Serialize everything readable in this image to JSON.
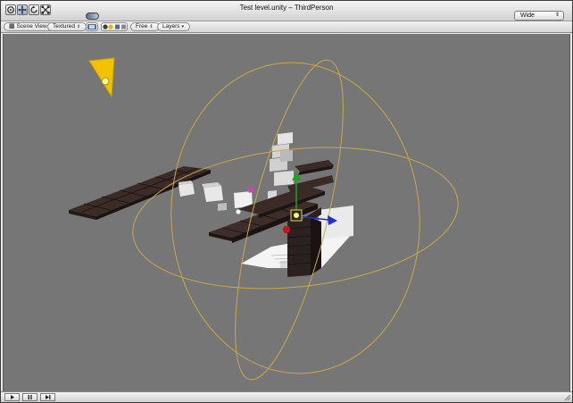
{
  "window": {
    "title": "Test level.unity – ThirdPerson"
  },
  "toolbar": {
    "tools": [
      {
        "name": "hand-tool",
        "icon": "hand-icon"
      },
      {
        "name": "move-tool",
        "icon": "move-arrows-icon"
      },
      {
        "name": "rotate-tool",
        "icon": "rotate-icon"
      },
      {
        "name": "scale-tool",
        "icon": "scale-icon"
      }
    ],
    "layout": {
      "selected": "Wide"
    }
  },
  "scene_bar": {
    "view_mode": "Scene View",
    "render_mode": "Textured",
    "camera_mode": "Free",
    "layers_label": "Layers"
  },
  "play_controls": [
    {
      "name": "play-button",
      "icon": "play-icon"
    },
    {
      "name": "pause-button",
      "icon": "pause-icon"
    },
    {
      "name": "step-button",
      "icon": "step-icon"
    }
  ],
  "colors": {
    "viewport_bg": "#767676",
    "gizmo_orbit": "#c8a94a",
    "light_cone": "#f2c200",
    "axis_y": "#1fa31f",
    "axis_x": "#d02020",
    "axis_z": "#1f2fd0"
  }
}
